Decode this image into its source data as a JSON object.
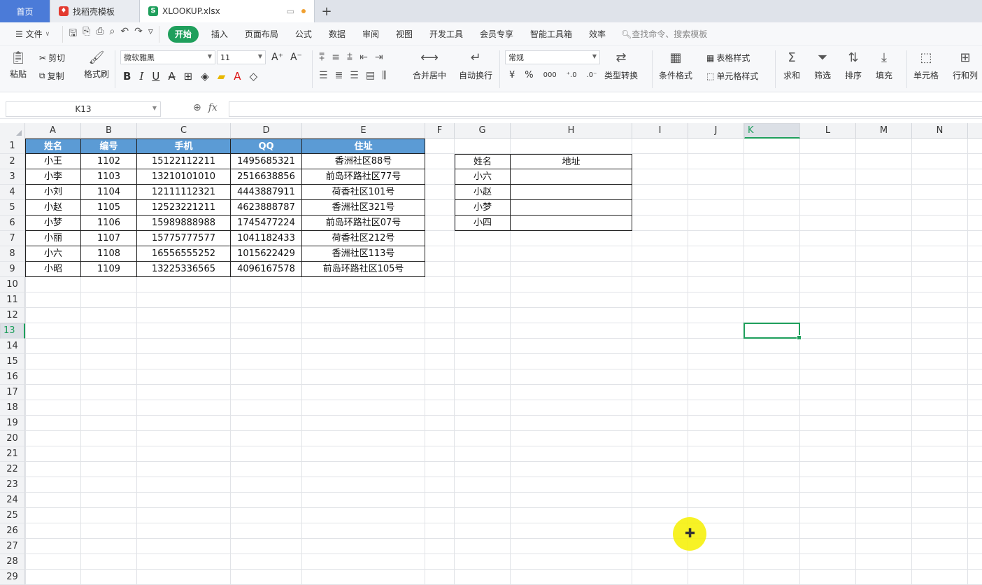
{
  "tabs": {
    "home": "首页",
    "template": "找稻壳模板",
    "file": "XLOOKUP.xlsx",
    "new_tab_icon": "plus-icon"
  },
  "menu": {
    "file": "文件",
    "items": [
      "开始",
      "插入",
      "页面布局",
      "公式",
      "数据",
      "审阅",
      "视图",
      "开发工具",
      "会员专享",
      "智能工具箱",
      "效率"
    ],
    "search": "查找命令、搜索模板"
  },
  "ribbon": {
    "paste": "粘贴",
    "cut": "剪切",
    "copy": "复制",
    "format_painter": "格式刷",
    "font_name": "微软雅黑",
    "font_size": "11",
    "bold": "B",
    "italic": "I",
    "underline": "U",
    "merge": "合并居中",
    "wrap": "自动换行",
    "number_format": "常规",
    "currency": "¥",
    "percent": "%",
    "thousands": "000",
    "type_convert": "类型转换",
    "cond_format": "条件格式",
    "table_style": "表格样式",
    "cell_style": "单元格样式",
    "sum": "求和",
    "filter": "筛选",
    "sort": "排序",
    "fill": "填充",
    "cell": "单元格",
    "row_col": "行和列"
  },
  "formula_bar": {
    "name_box": "K13",
    "fx": "fx",
    "value": ""
  },
  "columns": [
    "A",
    "B",
    "C",
    "D",
    "E",
    "F",
    "G",
    "H",
    "I",
    "J",
    "K",
    "L",
    "M",
    "N"
  ],
  "rows": [
    "1",
    "2",
    "3",
    "4",
    "5",
    "6",
    "7",
    "8",
    "9",
    "10",
    "11",
    "12",
    "13",
    "14",
    "15",
    "16",
    "17",
    "18",
    "19",
    "20",
    "21",
    "22",
    "23",
    "24",
    "25",
    "26",
    "27",
    "28",
    "29"
  ],
  "main_table": {
    "headers": [
      "姓名",
      "编号",
      "手机",
      "QQ",
      "住址"
    ],
    "rows": [
      [
        "小王",
        "1102",
        "15122112211",
        "1495685321",
        "香洲社区88号"
      ],
      [
        "小李",
        "1103",
        "13210101010",
        "2516638856",
        "前岛环路社区77号"
      ],
      [
        "小刘",
        "1104",
        "12111112321",
        "4443887911",
        "荷香社区101号"
      ],
      [
        "小赵",
        "1105",
        "12523221211",
        "4623888787",
        "香洲社区321号"
      ],
      [
        "小梦",
        "1106",
        "15989888988",
        "1745477224",
        "前岛环路社区07号"
      ],
      [
        "小丽",
        "1107",
        "15775777577",
        "1041182433",
        "荷香社区212号"
      ],
      [
        "小六",
        "1108",
        "16556555252",
        "1015622429",
        "香洲社区113号"
      ],
      [
        "小昭",
        "1109",
        "13225336565",
        "4096167578",
        "前岛环路社区105号"
      ]
    ]
  },
  "lookup_table": {
    "headers": [
      "姓名",
      "地址"
    ],
    "rows": [
      [
        "小六",
        ""
      ],
      [
        "小赵",
        ""
      ],
      [
        "小梦",
        ""
      ],
      [
        "小四",
        ""
      ]
    ]
  },
  "selected_cell": "K13"
}
